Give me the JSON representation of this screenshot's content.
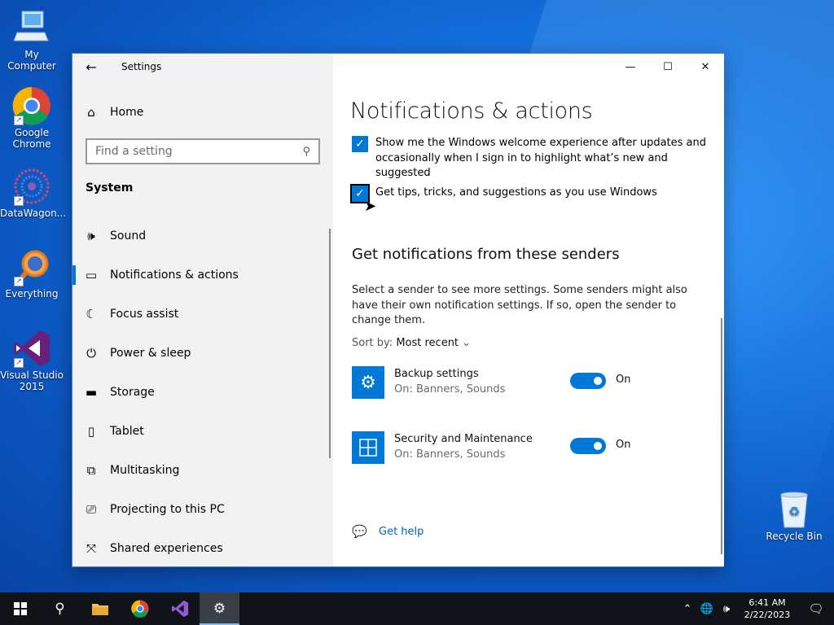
{
  "desktop": {
    "icons": [
      {
        "label": "My Computer"
      },
      {
        "label": "Google Chrome"
      },
      {
        "label": "DataWagon..."
      },
      {
        "label": "Everything"
      },
      {
        "label": "Visual Studio 2015"
      },
      {
        "label": "Recycle Bin"
      }
    ]
  },
  "window": {
    "app_title": "Settings",
    "nav": {
      "home_label": "Home",
      "search_placeholder": "Find a setting",
      "section_label": "System",
      "items": [
        {
          "label": "Sound",
          "icon": "speaker-icon"
        },
        {
          "label": "Notifications & actions",
          "icon": "notification-icon",
          "active": true
        },
        {
          "label": "Focus assist",
          "icon": "moon-icon"
        },
        {
          "label": "Power & sleep",
          "icon": "power-icon"
        },
        {
          "label": "Storage",
          "icon": "storage-icon"
        },
        {
          "label": "Tablet",
          "icon": "tablet-icon"
        },
        {
          "label": "Multitasking",
          "icon": "multitasking-icon"
        },
        {
          "label": "Projecting to this PC",
          "icon": "projector-icon"
        },
        {
          "label": "Shared experiences",
          "icon": "shared-icon"
        }
      ]
    },
    "content": {
      "page_title": "Notifications & actions",
      "options": [
        {
          "label": "Show me the Windows welcome experience after updates and occasionally when I sign in to highlight what’s new and suggested",
          "checked": true
        },
        {
          "label": "Get tips, tricks, and suggestions as you use Windows",
          "checked": true
        }
      ],
      "senders_title": "Get notifications from these senders",
      "senders_description": "Select a sender to see more settings. Some senders might also have their own notification settings. If so, open the sender to change them.",
      "sort_prefix": "Sort by:",
      "sort_value": "Most recent",
      "senders": [
        {
          "name": "Backup settings",
          "detail": "On: Banners, Sounds",
          "toggle_label": "On",
          "icon": "gear-icon"
        },
        {
          "name": "Security and Maintenance",
          "detail": "On: Banners, Sounds",
          "toggle_label": "On",
          "icon": "security-flag-icon"
        }
      ],
      "help_label": "Get help"
    }
  },
  "taskbar": {
    "time": "6:41 AM",
    "date": "2/22/2023"
  },
  "colors": {
    "accent": "#0078d7",
    "taskbar": "#101418",
    "nav_bg": "#f2f2f2",
    "link": "#0064b8"
  }
}
